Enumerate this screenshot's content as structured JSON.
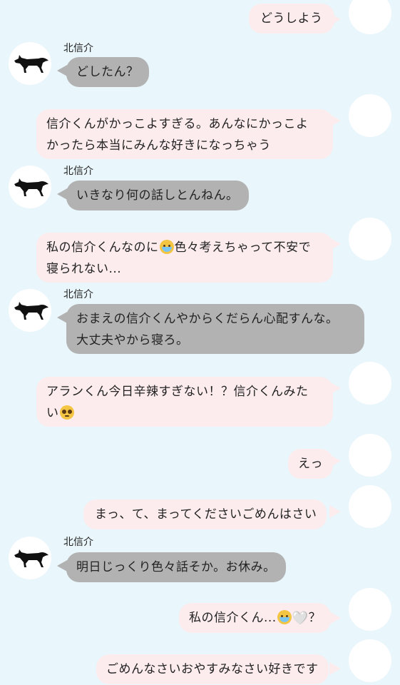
{
  "sender_name": "北信介",
  "messages": [
    {
      "from": "me",
      "text": "どうしよう"
    },
    {
      "from": "them",
      "text": "どしたん？"
    },
    {
      "from": "me",
      "line1": "信介くんがかっこよすぎる。あんなにかっこよ",
      "line2": "かったら本当にみんな好きになっちゃう"
    },
    {
      "from": "them",
      "text": "いきなり何の話しとんねん。"
    },
    {
      "from": "me",
      "line1a": "私の信介くんなのに",
      "emoji": "crying-face",
      "line1b": "色々考えちゃって不安で",
      "line2": "寝られない..."
    },
    {
      "from": "them",
      "line1": "おまえの信介くんやからくだらん心配すんな。",
      "line2": "大丈夫やから寝ろ。"
    },
    {
      "from": "me",
      "line1": "アランくん今日辛辣すぎない！？信介くんみた",
      "line2": "い",
      "emoji": "pleading-face"
    },
    {
      "from": "me",
      "text": "えっ"
    },
    {
      "from": "me",
      "text": "まっ、て、まってくださいごめんはさい"
    },
    {
      "from": "them",
      "text": "明日じっくり色々話そか。お休み。"
    },
    {
      "from": "me",
      "text_a": "私の信介くん...",
      "emoji": "crying-face",
      "heart": "🤍",
      "text_b": "？"
    },
    {
      "from": "me",
      "text": "ごめんなさいおやすみなさい好きです"
    }
  ]
}
